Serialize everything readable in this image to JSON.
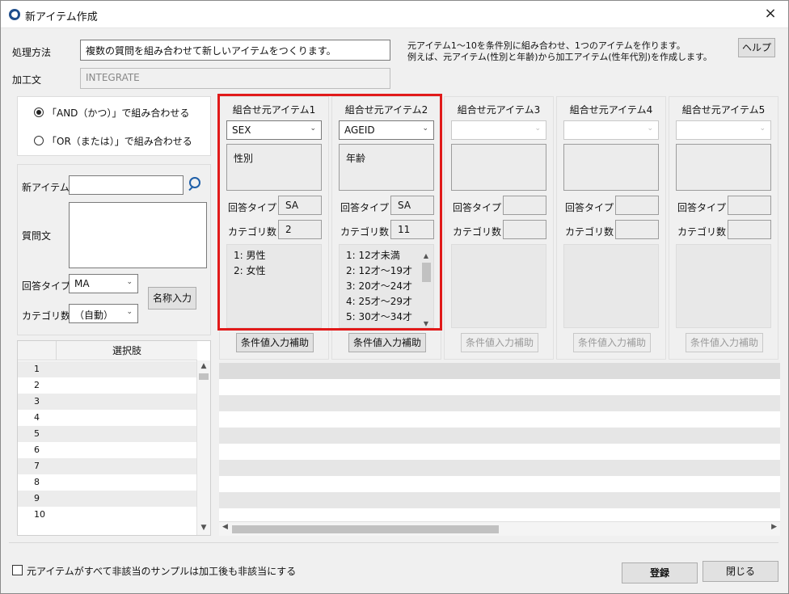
{
  "window": {
    "title": "新アイテム作成",
    "close": "×"
  },
  "top": {
    "method_label": "処理方法",
    "method_value": "複数の質問を組み合わせて新しいアイテムをつくります。",
    "expr_label": "加工文",
    "expr_value": "INTEGRATE",
    "note_line1": "元アイテム1～10を条件別に組み合わせ、1つのアイテムを作ります。",
    "note_line2": "例えば、元アイテム(性別と年齢)から加工アイテム(性年代別)を作成します。",
    "help_button": "ヘルプ"
  },
  "combine": {
    "and_option": "「AND（かつ）」で組み合わせる",
    "or_option": "「OR（または）」で組み合わせる",
    "selected": "and"
  },
  "new_item": {
    "name_label": "新アイテム",
    "name_value": "",
    "question_label": "質問文",
    "answer_type_label": "回答タイプ",
    "answer_type_value": "MA",
    "category_count_label": "カテゴリ数",
    "category_count_value": "（自動）",
    "name_input_button": "名称入力"
  },
  "choices_grid": {
    "header": "選択肢",
    "rows": [
      "1",
      "2",
      "3",
      "4",
      "5",
      "6",
      "7",
      "8",
      "9",
      "10"
    ]
  },
  "source_items": [
    {
      "header": "組合せ元アイテム1",
      "code": "SEX",
      "desc": "性別",
      "answer_type_label": "回答タイプ",
      "answer_type": "SA",
      "category_label": "カテゴリ数",
      "category_count": "2",
      "categories": [
        "1: 男性",
        "2: 女性"
      ],
      "assist_button": "条件値入力補助",
      "enabled": true
    },
    {
      "header": "組合せ元アイテム2",
      "code": "AGEID",
      "desc": "年齢",
      "answer_type_label": "回答タイプ",
      "answer_type": "SA",
      "category_label": "カテゴリ数",
      "category_count": "11",
      "categories": [
        "1: 12才未満",
        "2: 12才～19才",
        "3: 20才～24才",
        "4: 25才～29才",
        "5: 30才～34才"
      ],
      "assist_button": "条件値入力補助",
      "enabled": true
    },
    {
      "header": "組合せ元アイテム3",
      "code": "",
      "desc": "",
      "answer_type_label": "回答タイプ",
      "answer_type": "",
      "category_label": "カテゴリ数",
      "category_count": "",
      "categories": [],
      "assist_button": "条件値入力補助",
      "enabled": false
    },
    {
      "header": "組合せ元アイテム4",
      "code": "",
      "desc": "",
      "answer_type_label": "回答タイプ",
      "answer_type": "",
      "category_label": "カテゴリ数",
      "category_count": "",
      "categories": [],
      "assist_button": "条件値入力補助",
      "enabled": false
    },
    {
      "header": "組合せ元アイテム5",
      "code": "",
      "desc": "",
      "answer_type_label": "回答タイプ",
      "answer_type": "",
      "category_label": "カテゴリ数",
      "category_count": "",
      "categories": [],
      "assist_button": "条件値入力補助",
      "enabled": false
    }
  ],
  "bottom": {
    "checkbox_label": "元アイテムがすべて非該当のサンプルは加工後も非該当にする",
    "register_button": "登録",
    "close_button": "閉じる"
  },
  "colors": {
    "highlight": "#e11a1a",
    "accent": "#1f5fa8"
  }
}
